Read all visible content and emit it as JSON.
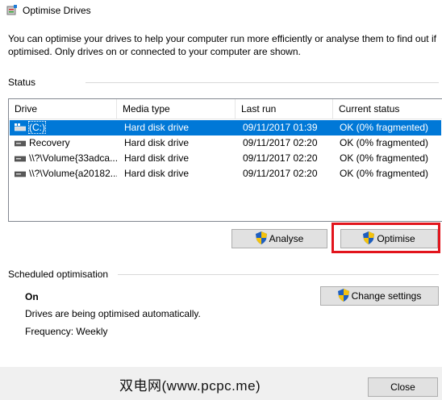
{
  "window": {
    "title": "Optimise Drives"
  },
  "intro_text": "You can optimise your drives to help your computer run more efficiently or analyse them to find out if optimised. Only drives on or connected to your computer are shown.",
  "status_label": "Status",
  "table": {
    "columns": [
      "Drive",
      "Media type",
      "Last run",
      "Current status"
    ],
    "rows": [
      {
        "drive": "(C:)",
        "media": "Hard disk drive",
        "last_run": "09/11/2017 01:39",
        "status": "OK (0% fragmented)",
        "icon": "windows-drive-icon"
      },
      {
        "drive": "Recovery",
        "media": "Hard disk drive",
        "last_run": "09/11/2017 02:20",
        "status": "OK (0% fragmented)",
        "icon": "drive-icon"
      },
      {
        "drive": "\\\\?\\Volume{33adca...",
        "media": "Hard disk drive",
        "last_run": "09/11/2017 02:20",
        "status": "OK (0% fragmented)",
        "icon": "drive-icon"
      },
      {
        "drive": "\\\\?\\Volume{a20182...",
        "media": "Hard disk drive",
        "last_run": "09/11/2017 02:20",
        "status": "OK (0% fragmented)",
        "icon": "drive-icon"
      }
    ]
  },
  "buttons": {
    "analyse": "Analyse",
    "optimise": "Optimise",
    "change_settings": "Change settings",
    "close": "Close"
  },
  "scheduled": {
    "label": "Scheduled optimisation",
    "state": "On",
    "description": "Drives are being optimised automatically.",
    "frequency": "Frequency: Weekly"
  },
  "watermark": "双电网(www.pcpc.me)",
  "colors": {
    "selection": "#0078d7",
    "highlight_box": "#e2141c"
  }
}
